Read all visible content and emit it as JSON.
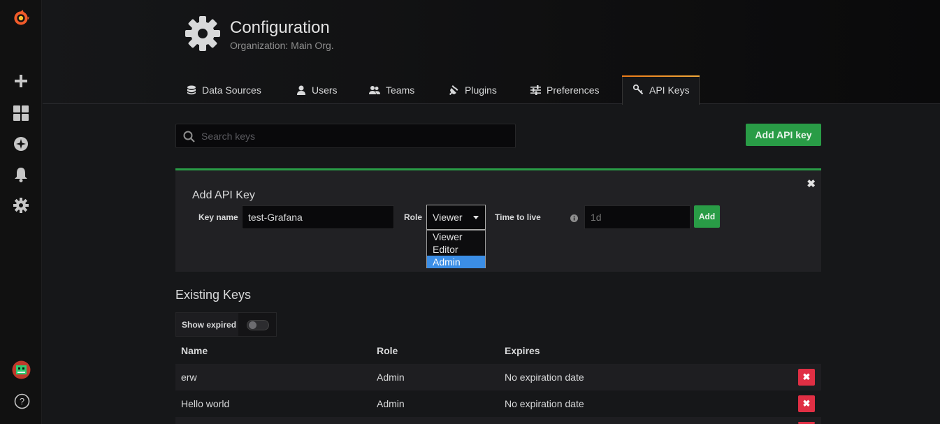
{
  "header": {
    "title": "Configuration",
    "subtitle": "Organization: Main Org."
  },
  "tabs": [
    {
      "label": "Data Sources",
      "icon": "database-icon"
    },
    {
      "label": "Users",
      "icon": "user-icon"
    },
    {
      "label": "Teams",
      "icon": "users-icon"
    },
    {
      "label": "Plugins",
      "icon": "plug-icon"
    },
    {
      "label": "Preferences",
      "icon": "sliders-icon"
    },
    {
      "label": "API Keys",
      "icon": "key-icon",
      "active": true
    }
  ],
  "search": {
    "placeholder": "Search keys",
    "value": ""
  },
  "add_button_label": "Add API key",
  "add_panel": {
    "title": "Add API Key",
    "key_name_label": "Key name",
    "key_name_value": "test-Grafana",
    "role_label": "Role",
    "role_value": "Viewer",
    "role_options": [
      "Viewer",
      "Editor",
      "Admin"
    ],
    "role_highlighted": "Admin",
    "ttl_label": "Time to live",
    "ttl_placeholder": "1d",
    "add_label": "Add",
    "close_glyph": "✖"
  },
  "existing": {
    "title": "Existing Keys",
    "show_expired_label": "Show expired",
    "show_expired": false,
    "columns": [
      "Name",
      "Role",
      "Expires"
    ],
    "rows": [
      {
        "name": "erw",
        "role": "Admin",
        "expires": "No expiration date"
      },
      {
        "name": "Hello world",
        "role": "Admin",
        "expires": "No expiration date"
      }
    ],
    "delete_glyph": "✖"
  },
  "colors": {
    "green": "#299c46",
    "red": "#e02f44",
    "select_highlight": "#3b8ee6",
    "tab_accent": "#eb7b18"
  }
}
